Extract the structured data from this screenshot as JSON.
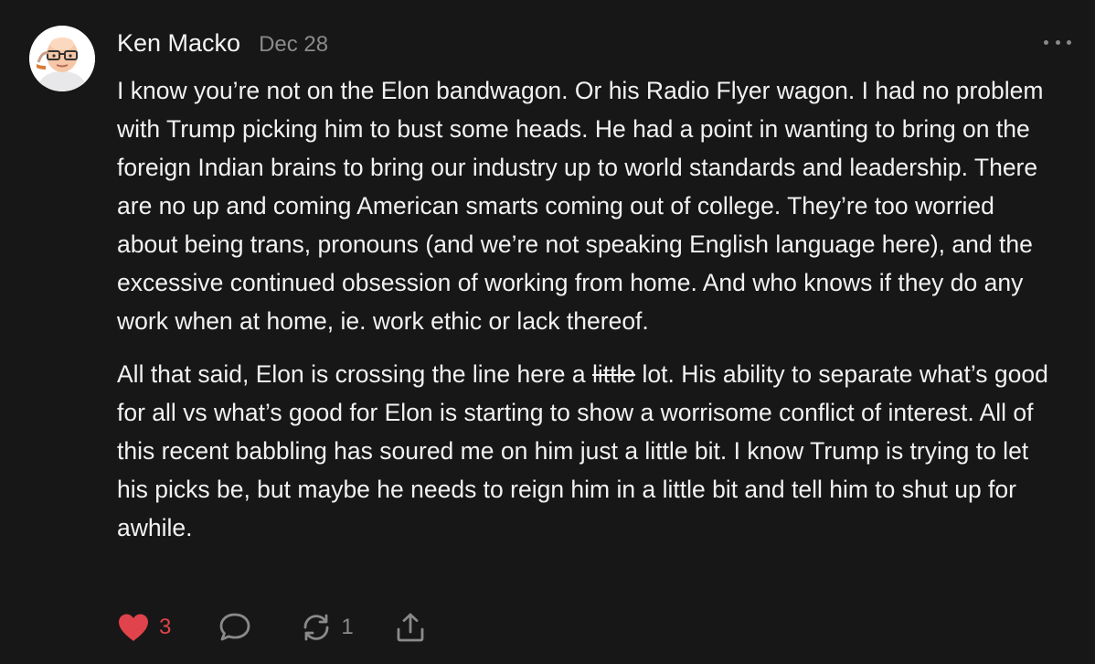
{
  "comment": {
    "author": "Ken Macko",
    "date": "Dec 28",
    "avatar_icon": "bald-man-glasses-avatar",
    "paragraph1": "I know you’re not on the Elon bandwagon. Or his Radio Flyer wagon. I had no problem with Trump picking him to bust some heads. He had a point in wanting to bring on the foreign Indian brains to bring our industry up to world standards and leadership. There are no up and coming American smarts coming out of college. They’re too worried about being trans, pronouns (and we’re not speaking English language here), and the excessive continued obsession of working from home. And who knows if they do any work when at home, ie. work ethic or lack thereof.",
    "paragraph2_before": "All that said, Elon is crossing the line here a ",
    "paragraph2_struck": "little",
    "paragraph2_after": " lot. His ability to separate what’s good for all vs what’s good for Elon is starting to show a worrisome conflict of interest. All of this recent babbling has soured me on him just a little bit. I know Trump is trying to let his picks be, but maybe he needs to reign him in a little bit and tell him to shut up for awhile."
  },
  "actions": {
    "likes": "3",
    "restacks": "1",
    "like_icon": "heart-icon",
    "comment_icon": "comment-bubble-icon",
    "restack_icon": "restack-icon",
    "share_icon": "share-icon",
    "more_icon": "more-options-icon"
  },
  "colors": {
    "background": "#171717",
    "text": "#f2f2f2",
    "muted": "#8a8a8a",
    "like_accent": "#e0434b"
  }
}
